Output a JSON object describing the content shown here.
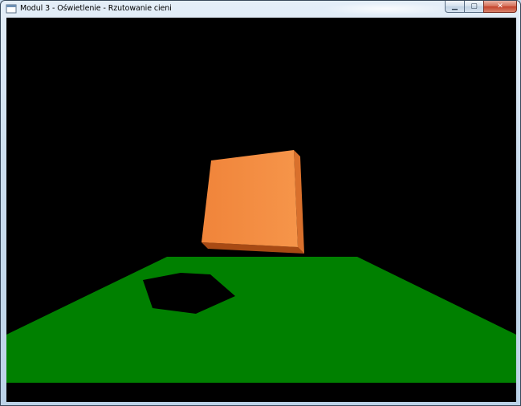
{
  "window": {
    "title": "Modul 3 - Oświetlenie - Rzutowanie cieni",
    "icon": "app-window-icon",
    "caption_buttons": {
      "minimize": "minimize-icon",
      "maximize": "maximize-icon",
      "close": "close-icon"
    }
  },
  "scene": {
    "background_color": "#000000",
    "floor_color": "#008000",
    "shadow_color": "#000000",
    "cube_front_color": "#f08a40",
    "cube_side_color": "#d9702c",
    "cube_bottom_color": "#a84a14"
  }
}
